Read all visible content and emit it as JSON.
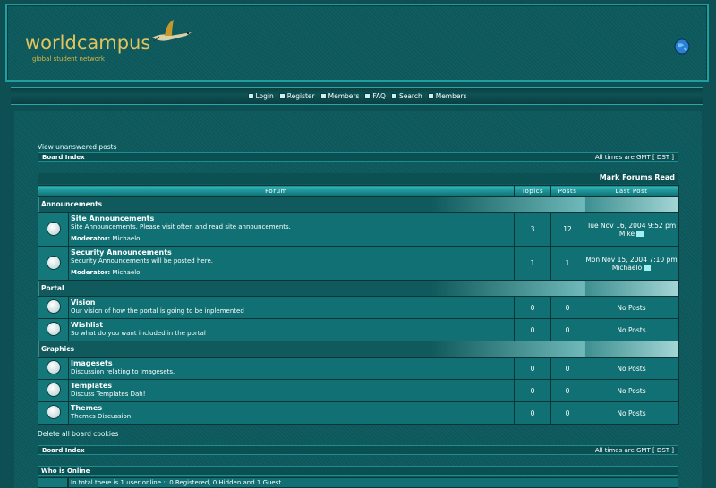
{
  "header": {
    "logo_text": "worldcampus",
    "logo_sub": "global student network"
  },
  "nav": [
    {
      "label": "Login",
      "icon": "login-icon"
    },
    {
      "label": "Register",
      "icon": "register-icon"
    },
    {
      "label": "Members",
      "icon": "members-icon"
    },
    {
      "label": "FAQ",
      "icon": "faq-icon"
    },
    {
      "label": "Search",
      "icon": "search-icon"
    },
    {
      "label": "Members",
      "icon": "members-icon"
    }
  ],
  "links": {
    "unanswered": "View unanswered posts",
    "delete_cookies": "Delete all board cookies",
    "mark_read": "Mark Forums Read"
  },
  "board_bar": {
    "index": "Board Index",
    "timezone": "All times are GMT [ DST ]"
  },
  "columns": {
    "forum": "Forum",
    "topics": "Topics",
    "posts": "Posts",
    "last_post": "Last Post"
  },
  "categories": [
    {
      "name": "Announcements",
      "forums": [
        {
          "name": "Site Announcements",
          "desc": "Site Announcements. Please visit often and read site announcements.",
          "mod_label": "Moderator:",
          "mod": "Michaelo",
          "topics": "3",
          "posts": "12",
          "last_date": "Tue Nov 16, 2004 9:52 pm",
          "last_user": "Mike"
        },
        {
          "name": "Security Announcements",
          "desc": "Security Announcements will be posted here.",
          "mod_label": "Moderator:",
          "mod": "Michaelo",
          "topics": "1",
          "posts": "1",
          "last_date": "Mon Nov 15, 2004 7:10 pm",
          "last_user": "Michaelo"
        }
      ]
    },
    {
      "name": "Portal",
      "forums": [
        {
          "name": "Vision",
          "desc": "Our vision of how the portal is going to be inplemented",
          "topics": "0",
          "posts": "0",
          "last": "No Posts"
        },
        {
          "name": "Wishlist",
          "desc": "So what do you want included in the portal",
          "topics": "0",
          "posts": "0",
          "last": "No Posts"
        }
      ]
    },
    {
      "name": "Graphics",
      "forums": [
        {
          "name": "Imagesets",
          "desc": "Discussion relating to Imagesets.",
          "topics": "0",
          "posts": "0",
          "last": "No Posts"
        },
        {
          "name": "Templates",
          "desc": "Discuss Templates Dah!",
          "topics": "0",
          "posts": "0",
          "last": "No Posts"
        },
        {
          "name": "Themes",
          "desc": "Themes Discussion",
          "topics": "0",
          "posts": "0",
          "last": "No Posts"
        }
      ]
    }
  ],
  "who_online": {
    "title": "Who is Online",
    "text": "In total there is 1 user online :: 0 Registered, 0 Hidden and 1 Guest"
  }
}
